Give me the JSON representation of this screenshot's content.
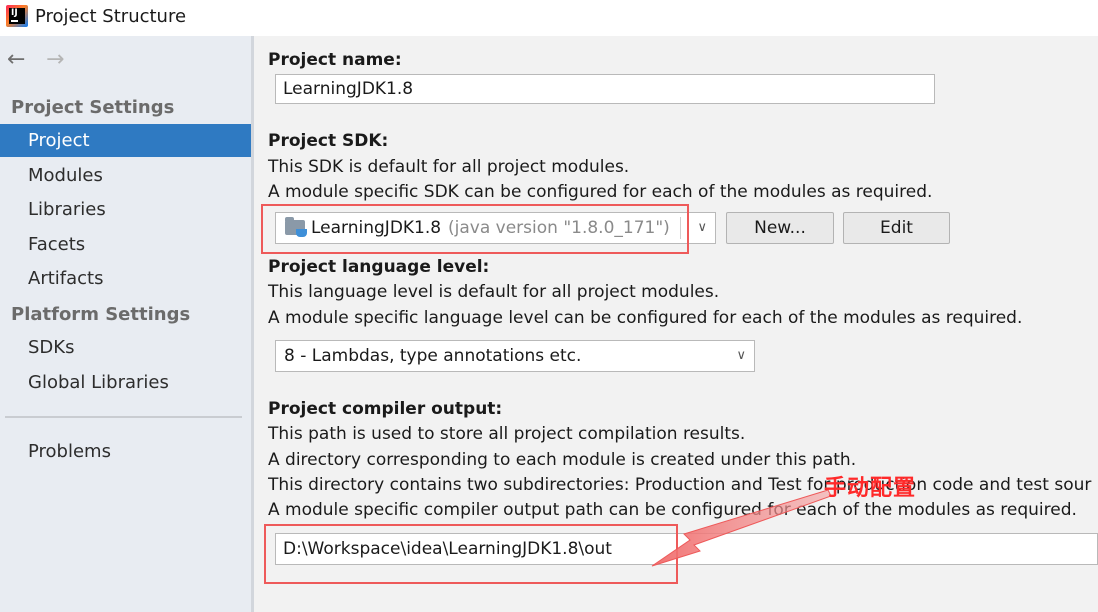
{
  "window": {
    "title": "Project Structure"
  },
  "nav": {
    "back_icon": "arrow-left-icon",
    "forward_icon": "arrow-right-icon"
  },
  "sidebar": {
    "project_settings_header": "Project Settings",
    "platform_settings_header": "Platform Settings",
    "project_items": [
      "Project",
      "Modules",
      "Libraries",
      "Facets",
      "Artifacts"
    ],
    "platform_items": [
      "SDKs",
      "Global Libraries"
    ],
    "problems": "Problems",
    "selected": "Project"
  },
  "main": {
    "project_name": {
      "label": "Project name:",
      "value": "LearningJDK1.8"
    },
    "project_sdk": {
      "label": "Project SDK:",
      "desc1": "This SDK is default for all project modules.",
      "desc2": "A module specific SDK can be configured for each of the modules as required.",
      "selected_sdk": "LearningJDK1.8",
      "selected_sdk_detail": "(java version \"1.8.0_171\")",
      "new_button": "New...",
      "edit_button": "Edit"
    },
    "language_level": {
      "label": "Project language level:",
      "desc1": "This language level is default for all project modules.",
      "desc2": "A module specific language level can be configured for each of the modules as required.",
      "value": "8 - Lambdas, type annotations etc."
    },
    "compiler_output": {
      "label": "Project compiler output:",
      "desc1": "This path is used to store all project compilation results.",
      "desc2": "A directory corresponding to each module is created under this path.",
      "desc3": "This directory contains two subdirectories: Production and Test for production code and test sour",
      "desc4": "A module specific compiler output path can be configured for each of the modules as required.",
      "value": "D:\\Workspace\\idea\\LearningJDK1.8\\out"
    }
  },
  "annotation": {
    "text": "手动配置",
    "color": "#ff2a2a"
  },
  "colors": {
    "selection": "#2f7ac2",
    "highlight": "#ee5a5a"
  }
}
